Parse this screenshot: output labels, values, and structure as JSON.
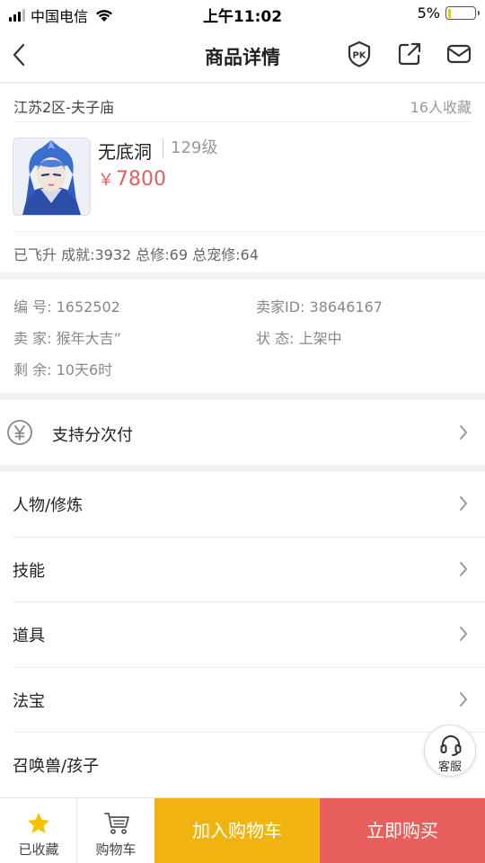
{
  "status_bar": {
    "carrier": "中国电信",
    "time": "上午11:02",
    "battery_text": "5%",
    "battery_level": 0.05,
    "signal_bars": 3
  },
  "nav": {
    "title": "商品详情",
    "icons": [
      "back-arrow-icon",
      "pk-badge-icon",
      "share-icon",
      "mail-icon"
    ]
  },
  "product": {
    "server": "江苏2区-夫子庙",
    "fav_count": "16人收藏",
    "name": "无底洞",
    "level": "129级",
    "currency": "￥",
    "price": "7800",
    "attrs": "已飞升 成就:3932 总修:69 总宠修:64"
  },
  "info": {
    "id_label": "编  号:",
    "id_value": "1652502",
    "seller_id_label": "卖家ID:",
    "seller_id_value": "38646167",
    "seller_label": "卖  家:",
    "seller_value": "猴年大吉”",
    "status_label": "状  态:",
    "status_value": "上架中",
    "remain_label": "剩  余:",
    "remain_value": "10天6时"
  },
  "installment": {
    "label": "支持分次付",
    "icon": "yen-circle-icon"
  },
  "menu": {
    "items": [
      {
        "label": "人物/修炼"
      },
      {
        "label": "技能"
      },
      {
        "label": "道具"
      },
      {
        "label": "法宝"
      },
      {
        "label": "召唤兽/孩子"
      }
    ]
  },
  "customer_service": {
    "label": "客服",
    "icon": "headset-icon"
  },
  "bottom_bar": {
    "fav_label": "已收藏",
    "cart_label": "购物车",
    "add_to_cart": "加入购物车",
    "buy_now": "立即购买"
  },
  "colors": {
    "price": "#e0605d",
    "add_to_cart_bg": "#f0b310",
    "buy_now_bg": "#e8605d",
    "star": "#f5c400"
  }
}
